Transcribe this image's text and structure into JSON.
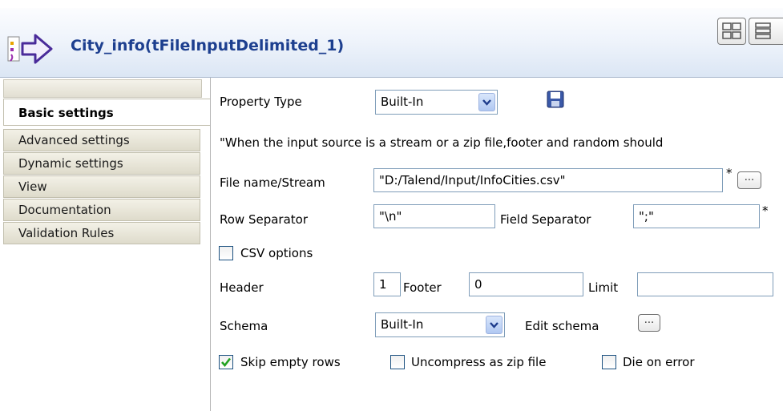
{
  "header": {
    "title": "City_info(tFileInputDelimited_1)",
    "icon": "component-arrow-icon",
    "layout_buttons": [
      "grid-layout-icon",
      "list-layout-icon"
    ]
  },
  "sidebar": {
    "tabs": [
      {
        "label": "Basic settings",
        "active": true
      },
      {
        "label": "Advanced settings",
        "active": false
      },
      {
        "label": "Dynamic settings",
        "active": false
      },
      {
        "label": "View",
        "active": false
      },
      {
        "label": "Documentation",
        "active": false
      },
      {
        "label": "Validation Rules",
        "active": false
      }
    ]
  },
  "form": {
    "property_type_label": "Property Type",
    "property_type_value": "Built-In",
    "notice": "\"When the input source is a stream or a zip file,footer and random should",
    "file_name_label": "File name/Stream",
    "file_name_value": "\"D:/Talend/Input/InfoCities.csv\"",
    "row_separator_label": "Row Separator",
    "row_separator_value": "\"\\n\"",
    "field_separator_label": "Field Separator",
    "field_separator_value": "\";\"",
    "required_marker": "*",
    "csv_options_label": "CSV options",
    "csv_options_checked": false,
    "header_label": "Header",
    "header_value": "1",
    "footer_label": "Footer",
    "footer_value": "0",
    "limit_label": "Limit",
    "limit_value": "",
    "schema_label": "Schema",
    "schema_value": "Built-In",
    "edit_schema_label": "Edit schema",
    "browse_label": "...",
    "skip_empty_rows_label": "Skip empty rows",
    "skip_empty_rows_checked": true,
    "uncompress_label": "Uncompress as zip file",
    "uncompress_checked": false,
    "die_on_error_label": "Die on error",
    "die_on_error_checked": false
  },
  "colors": {
    "title": "#1d3f8f",
    "field_border": "#7f9db9",
    "checkbox_border": "#1c5180",
    "check_mark": "#21a121"
  }
}
